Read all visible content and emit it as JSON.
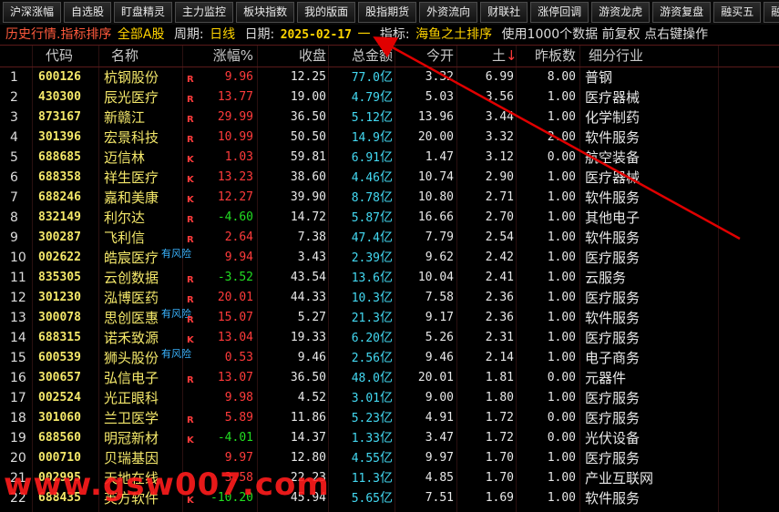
{
  "toolbar": {
    "buttons": [
      "沪深涨幅",
      "自选股",
      "盯盘精灵",
      "主力监控",
      "板块指数",
      "我的版面",
      "股指期货",
      "外资流向",
      "财联社",
      "涨停回调",
      "游资龙虎",
      "游资复盘",
      "融买五",
      "融买"
    ]
  },
  "info_bar": {
    "history": "历史行情.指标排序",
    "scope": "全部A股",
    "period_label": "周期:",
    "period_value": "日线",
    "date_label": "日期:",
    "date_value": "2025-02-17",
    "dash": "一",
    "indicator_label": "指标:",
    "indicator_value": "海鱼之土排序",
    "note": "使用1000个数据 前复权 点右键操作"
  },
  "table": {
    "headers": {
      "code": "代码",
      "name": "名称",
      "change": "涨幅%",
      "close": "收盘",
      "amount": "总金额",
      "open": "今开",
      "tu": "土",
      "boards": "昨板数",
      "industry": "细分行业"
    },
    "rows": [
      {
        "idx": "1",
        "code": "600126",
        "name": "杭钢股份",
        "flag": "R",
        "risk": "",
        "chg": "9.96",
        "dir": "up",
        "close": "12.25",
        "amt": "77.0",
        "unit": "亿",
        "open": "3.32",
        "tu": "6.99",
        "boards": "8.00",
        "ind": "普钢"
      },
      {
        "idx": "2",
        "code": "430300",
        "name": "辰光医疗",
        "flag": "R",
        "risk": "",
        "chg": "13.77",
        "dir": "up",
        "close": "19.00",
        "amt": "4.79",
        "unit": "亿",
        "open": "5.03",
        "tu": "3.56",
        "boards": "1.00",
        "ind": "医疗器械"
      },
      {
        "idx": "3",
        "code": "873167",
        "name": "新赣江",
        "flag": "R",
        "risk": "",
        "chg": "29.99",
        "dir": "up",
        "close": "36.50",
        "amt": "5.12",
        "unit": "亿",
        "open": "13.96",
        "tu": "3.44",
        "boards": "1.00",
        "ind": "化学制药"
      },
      {
        "idx": "4",
        "code": "301396",
        "name": "宏景科技",
        "flag": "R",
        "risk": "",
        "chg": "10.99",
        "dir": "up",
        "close": "50.50",
        "amt": "14.9",
        "unit": "亿",
        "open": "20.00",
        "tu": "3.32",
        "boards": "2.00",
        "ind": "软件服务"
      },
      {
        "idx": "5",
        "code": "688685",
        "name": "迈信林",
        "flag": "K",
        "risk": "",
        "chg": "1.03",
        "dir": "up",
        "close": "59.81",
        "amt": "6.91",
        "unit": "亿",
        "open": "1.47",
        "tu": "3.12",
        "boards": "0.00",
        "ind": "航空装备"
      },
      {
        "idx": "6",
        "code": "688358",
        "name": "祥生医疗",
        "flag": "K",
        "risk": "",
        "chg": "13.23",
        "dir": "up",
        "close": "38.60",
        "amt": "4.46",
        "unit": "亿",
        "open": "10.74",
        "tu": "2.90",
        "boards": "1.00",
        "ind": "医疗器械"
      },
      {
        "idx": "7",
        "code": "688246",
        "name": "嘉和美康",
        "flag": "K",
        "risk": "",
        "chg": "12.27",
        "dir": "up",
        "close": "39.90",
        "amt": "8.78",
        "unit": "亿",
        "open": "10.80",
        "tu": "2.71",
        "boards": "1.00",
        "ind": "软件服务"
      },
      {
        "idx": "8",
        "code": "832149",
        "name": "利尔达",
        "flag": "R",
        "risk": "",
        "chg": "-4.60",
        "dir": "down",
        "close": "14.72",
        "amt": "5.87",
        "unit": "亿",
        "open": "16.66",
        "tu": "2.70",
        "boards": "1.00",
        "ind": "其他电子"
      },
      {
        "idx": "9",
        "code": "300287",
        "name": "飞利信",
        "flag": "R",
        "risk": "",
        "chg": "2.64",
        "dir": "up",
        "close": "7.38",
        "amt": "47.4",
        "unit": "亿",
        "open": "7.79",
        "tu": "2.54",
        "boards": "1.00",
        "ind": "软件服务"
      },
      {
        "idx": "10",
        "code": "002622",
        "name": "皓宸医疗",
        "flag": "",
        "risk": "有风险",
        "chg": "9.94",
        "dir": "up",
        "close": "3.43",
        "amt": "2.39",
        "unit": "亿",
        "open": "9.62",
        "tu": "2.42",
        "boards": "1.00",
        "ind": "医疗服务"
      },
      {
        "idx": "11",
        "code": "835305",
        "name": "云创数据",
        "flag": "R",
        "risk": "",
        "chg": "-3.52",
        "dir": "down",
        "close": "43.54",
        "amt": "13.6",
        "unit": "亿",
        "open": "10.04",
        "tu": "2.41",
        "boards": "1.00",
        "ind": "云服务"
      },
      {
        "idx": "12",
        "code": "301230",
        "name": "泓博医药",
        "flag": "R",
        "risk": "",
        "chg": "20.01",
        "dir": "up",
        "close": "44.33",
        "amt": "10.3",
        "unit": "亿",
        "open": "7.58",
        "tu": "2.36",
        "boards": "1.00",
        "ind": "医疗服务"
      },
      {
        "idx": "13",
        "code": "300078",
        "name": "思创医惠",
        "flag": "R",
        "risk": "有风险",
        "chg": "15.07",
        "dir": "up",
        "close": "5.27",
        "amt": "21.3",
        "unit": "亿",
        "open": "9.17",
        "tu": "2.36",
        "boards": "1.00",
        "ind": "软件服务"
      },
      {
        "idx": "14",
        "code": "688315",
        "name": "诺禾致源",
        "flag": "K",
        "risk": "",
        "chg": "13.04",
        "dir": "up",
        "close": "19.33",
        "amt": "6.20",
        "unit": "亿",
        "open": "5.26",
        "tu": "2.31",
        "boards": "1.00",
        "ind": "医疗服务"
      },
      {
        "idx": "15",
        "code": "600539",
        "name": "狮头股份",
        "flag": "",
        "risk": "有风险",
        "chg": "0.53",
        "dir": "up",
        "close": "9.46",
        "amt": "2.56",
        "unit": "亿",
        "open": "9.46",
        "tu": "2.14",
        "boards": "1.00",
        "ind": "电子商务"
      },
      {
        "idx": "16",
        "code": "300657",
        "name": "弘信电子",
        "flag": "R",
        "risk": "",
        "chg": "13.07",
        "dir": "up",
        "close": "36.50",
        "amt": "48.0",
        "unit": "亿",
        "open": "20.01",
        "tu": "1.81",
        "boards": "0.00",
        "ind": "元器件"
      },
      {
        "idx": "17",
        "code": "002524",
        "name": "光正眼科",
        "flag": "",
        "risk": "",
        "chg": "9.98",
        "dir": "up",
        "close": "4.52",
        "amt": "3.01",
        "unit": "亿",
        "open": "9.00",
        "tu": "1.80",
        "boards": "1.00",
        "ind": "医疗服务"
      },
      {
        "idx": "18",
        "code": "301060",
        "name": "兰卫医学",
        "flag": "R",
        "risk": "",
        "chg": "5.89",
        "dir": "up",
        "close": "11.86",
        "amt": "5.23",
        "unit": "亿",
        "open": "4.91",
        "tu": "1.72",
        "boards": "0.00",
        "ind": "医疗服务"
      },
      {
        "idx": "19",
        "code": "688560",
        "name": "明冠新材",
        "flag": "K",
        "risk": "",
        "chg": "-4.01",
        "dir": "down",
        "close": "14.37",
        "amt": "1.33",
        "unit": "亿",
        "open": "3.47",
        "tu": "1.72",
        "boards": "0.00",
        "ind": "光伏设备"
      },
      {
        "idx": "20",
        "code": "000710",
        "name": "贝瑞基因",
        "flag": "",
        "risk": "",
        "chg": "9.97",
        "dir": "up",
        "close": "12.80",
        "amt": "4.55",
        "unit": "亿",
        "open": "9.97",
        "tu": "1.70",
        "boards": "1.00",
        "ind": "医疗服务"
      },
      {
        "idx": "21",
        "code": "002995",
        "name": "天地在线",
        "flag": "",
        "risk": "",
        "chg": "3.58",
        "dir": "up",
        "close": "22.23",
        "amt": "11.3",
        "unit": "亿",
        "open": "4.85",
        "tu": "1.70",
        "boards": "1.00",
        "ind": "产业互联网"
      },
      {
        "idx": "22",
        "code": "688435",
        "name": "英方软件",
        "flag": "K",
        "risk": "",
        "chg": "-10.20",
        "dir": "down",
        "close": "45.94",
        "amt": "5.65",
        "unit": "亿",
        "open": "7.51",
        "tu": "1.69",
        "boards": "1.00",
        "ind": "软件服务"
      }
    ]
  },
  "watermark": "www.gsw007.com",
  "colors": {
    "up": "#ff3b3b",
    "down": "#22dd22",
    "amount": "#43d9f2",
    "code": "#f4e86a",
    "arrow": "#e00000"
  }
}
